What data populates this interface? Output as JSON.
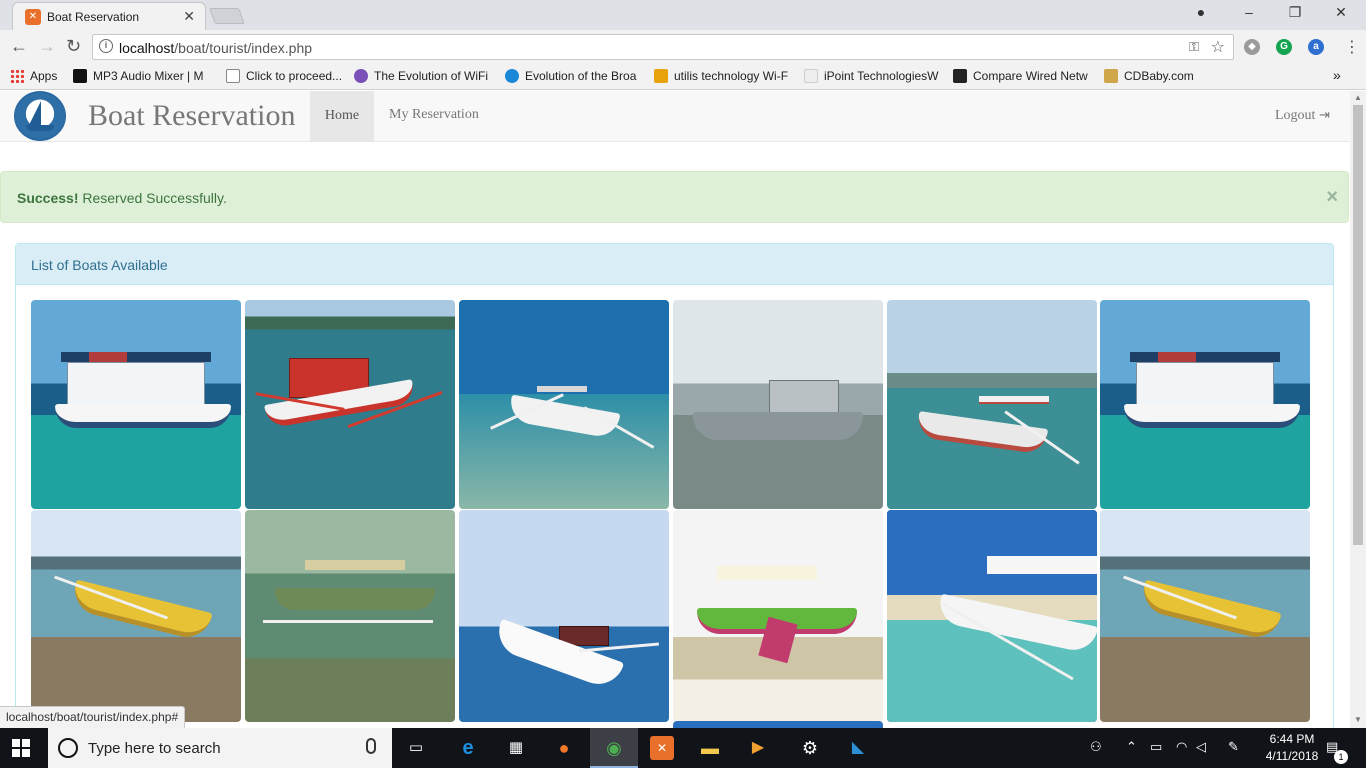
{
  "browser": {
    "tab_title": "Boat Reservation",
    "url_host": "localhost",
    "url_path": "/boat/tourist/index.php",
    "bookmarks": [
      {
        "label": "Apps"
      },
      {
        "label": "MP3 Audio Mixer | M"
      },
      {
        "label": "Click to proceed..."
      },
      {
        "label": "The Evolution of WiFi"
      },
      {
        "label": "Evolution of the Broa"
      },
      {
        "label": "utilis technology Wi-F"
      },
      {
        "label": "iPoint TechnologiesW"
      },
      {
        "label": "Compare Wired Netw"
      },
      {
        "label": "CDBaby.com"
      }
    ],
    "overflow": "»",
    "status_url": "localhost/boat/tourist/index.php#"
  },
  "app": {
    "brand": "Boat Reservation",
    "nav_home": "Home",
    "nav_reservation": "My Reservation",
    "nav_logout": "Logout",
    "alert_strong": "Success!",
    "alert_text": " Reserved Successfully.",
    "alert_close": "×",
    "panel_title": "List of Boats Available"
  },
  "taskbar": {
    "search_placeholder": "Type here to search",
    "time": "6:44 PM",
    "date": "4/11/2018",
    "notification_count": "1"
  },
  "colors": {
    "alert_bg": "#dff0d8",
    "alert_text": "#3c763d",
    "panel_heading_bg": "#d9edf7",
    "panel_title": "#31708f"
  }
}
